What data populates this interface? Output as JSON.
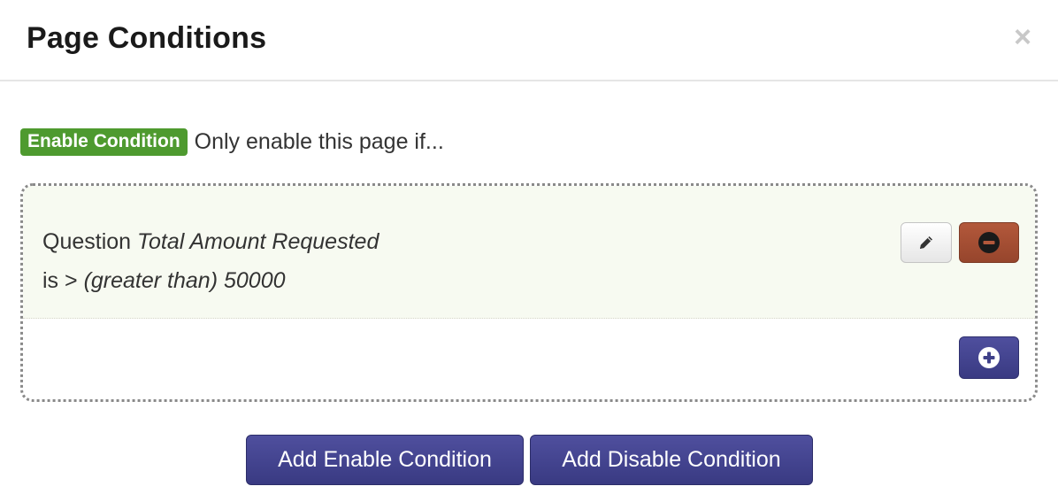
{
  "modal": {
    "title": "Page Conditions",
    "close_symbol": "×"
  },
  "intro": {
    "badge": "Enable Condition",
    "text": "Only enable this page if..."
  },
  "condition": {
    "prefix": "Question",
    "question_name": "Total Amount Requested",
    "operator_prefix": "is >",
    "operator_desc": "(greater than)",
    "value": "50000"
  },
  "icons": {
    "edit": "pencil-icon",
    "remove": "minus-circle-icon",
    "add": "plus-circle-icon",
    "close": "close-icon"
  },
  "colors": {
    "badge_green": "#4e9a2f",
    "remove_red": "#a24e33",
    "primary_navy": "#3f4089",
    "row_bg": "#f7faf1"
  },
  "footer": {
    "add_enable_label": "Add Enable Condition",
    "add_disable_label": "Add Disable Condition"
  }
}
